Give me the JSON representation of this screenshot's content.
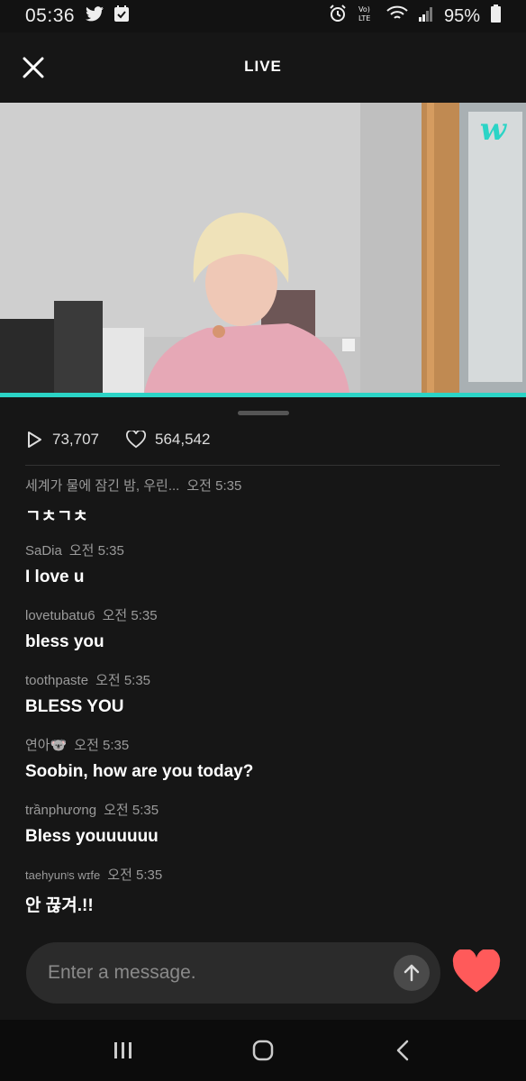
{
  "status_bar": {
    "time": "05:36",
    "battery": "95%",
    "icons": [
      "twitter-icon",
      "check-box-icon",
      "alarm-icon",
      "volte-icon",
      "wifi-icon",
      "signal-icon",
      "battery-icon"
    ]
  },
  "header": {
    "title": "LIVE"
  },
  "video": {
    "watermark": "w",
    "progress": 1.0,
    "accent_color": "#2bd4c6"
  },
  "stats": {
    "plays": "73,707",
    "likes": "564,542"
  },
  "chat": [
    {
      "user": "세계가 물에 잠긴 밤, 우린...",
      "time": "오전 5:35",
      "text": "ㄱㅊㄱㅊ"
    },
    {
      "user": "SaDia",
      "time": "오전 5:35",
      "text": "I love u"
    },
    {
      "user": "lovetubatu6",
      "time": "오전 5:35",
      "text": "bless you"
    },
    {
      "user": "toothpaste",
      "time": "오전 5:35",
      "text": "BLESS YOU"
    },
    {
      "user": "연아🐨",
      "time": "오전 5:35",
      "text": "Soobin, how are you today?"
    },
    {
      "user": "trầnphương",
      "time": "오전 5:35",
      "text": "Bless youuuuuu"
    },
    {
      "user": "taehyunᵎs wɪfe",
      "time": "오전 5:35",
      "text": "안 끊겨.!!"
    }
  ],
  "composer": {
    "placeholder": "Enter a message.",
    "heart_color": "#ff5a5a"
  }
}
